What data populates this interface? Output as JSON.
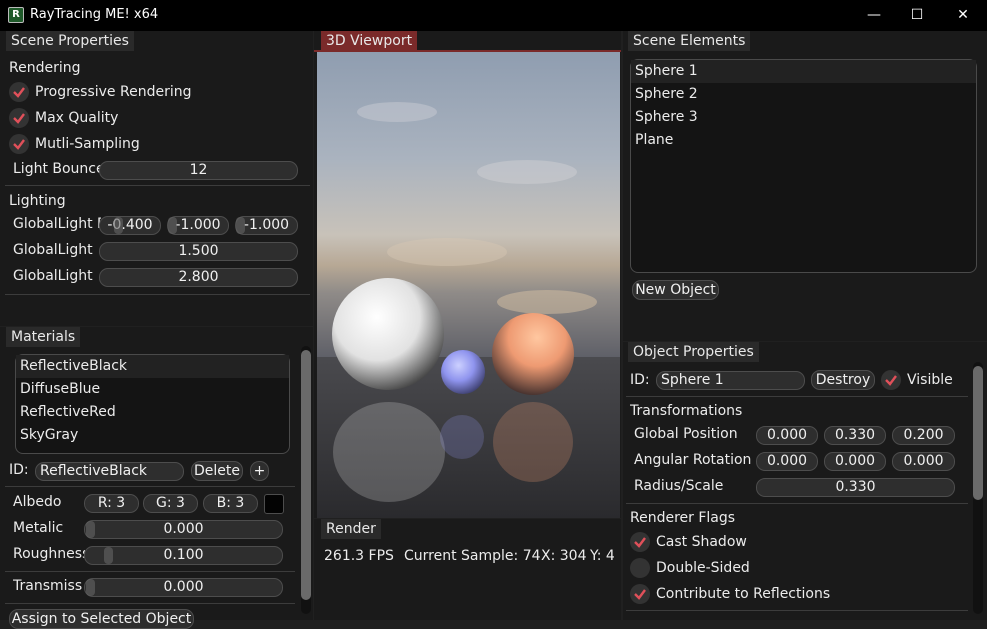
{
  "window": {
    "title": "RayTracing ME! x64",
    "icon_glyph": "R",
    "buttons": [
      "—",
      "☐",
      "✕"
    ]
  },
  "scene_props": {
    "tab": "Scene Properties",
    "rendering_heading": "Rendering",
    "checks": [
      {
        "label": "Progressive Rendering",
        "checked": true
      },
      {
        "label": "Max Quality",
        "checked": true
      },
      {
        "label": "Mutli-Sampling",
        "checked": true
      }
    ],
    "bounces_label": "Light Bounce",
    "bounces_value": "12",
    "lighting_heading": "Lighting",
    "light_dir_label": "GlobalLight D",
    "light_dir": [
      "-0.400",
      "-1.000",
      "-1.000"
    ],
    "light_int_label": "GlobalLight I",
    "light_int": "1.500",
    "light_n_label": "GlobalLight I",
    "light_n": "2.800"
  },
  "materials": {
    "tab": "Materials",
    "items": [
      "ReflectiveBlack",
      "DiffuseBlue",
      "ReflectiveRed",
      "SkyGray"
    ],
    "id_label": "ID:",
    "id_value": "ReflectiveBlack",
    "delete_label": "Delete",
    "add_label": "+",
    "albedo_label": "Albedo",
    "albedo_r": "R:  3",
    "albedo_g": "G:  3",
    "albedo_b": "B:  3",
    "metalic_label": "Metalic",
    "metalic_value": "0.000",
    "roughness_label": "Roughness",
    "roughness_value": "0.100",
    "transmission_label": "Transmiss",
    "transmission_value": "0.000",
    "assign_label": "Assign to Selected Object"
  },
  "viewport": {
    "tab": "3D Viewport"
  },
  "render": {
    "tab": "Render",
    "fps": "261.3 FPS",
    "sample": "Current Sample: 74",
    "x": "X: 304",
    "y": "Y: 4"
  },
  "scene_elements": {
    "tab": "Scene Elements",
    "items": [
      "Sphere 1",
      "Sphere 2",
      "Sphere 3",
      "Plane"
    ],
    "new_label": "New Object"
  },
  "object_props": {
    "tab": "Object Properties",
    "id_label": "ID:",
    "id_value": "Sphere 1",
    "destroy_label": "Destroy",
    "visible_label": "Visible",
    "transform_heading": "Transformations",
    "position_label": "Global Position",
    "position": [
      "0.000",
      "0.330",
      "0.200"
    ],
    "rotation_label": "Angular Rotation",
    "rotation": [
      "0.000",
      "0.000",
      "0.000"
    ],
    "radius_label": "Radius/Scale",
    "radius_value": "0.330",
    "flags_heading": "Renderer Flags",
    "flags": [
      {
        "label": "Cast Shadow",
        "checked": true
      },
      {
        "label": "Double-Sided",
        "checked": false
      },
      {
        "label": "Contribute to Reflections",
        "checked": true
      }
    ]
  },
  "colors": {
    "accent_tab": "#7a2a2a",
    "check": "#e0505a",
    "panel": "#1a1a1a"
  }
}
